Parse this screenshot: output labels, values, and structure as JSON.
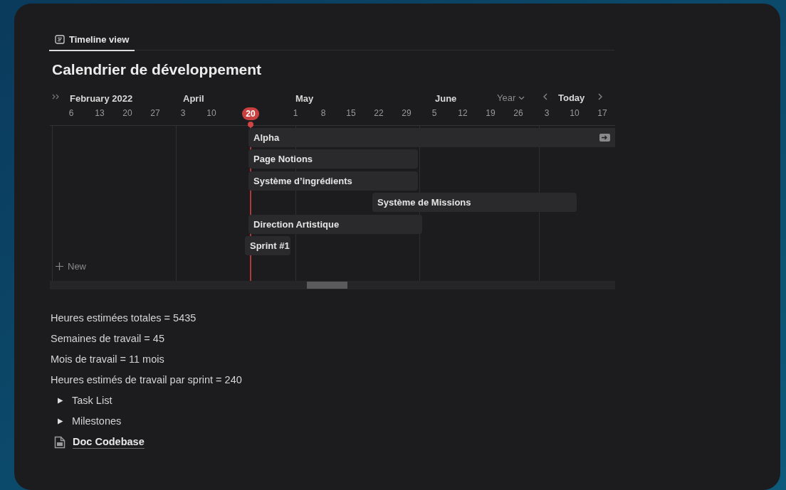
{
  "tabs": [
    {
      "label": "Timeline view",
      "selected": true
    }
  ],
  "title": "Calendrier de développement",
  "timeline": {
    "months": [
      "February 2022",
      "April",
      "May",
      "June"
    ],
    "controls": {
      "scale": "Year",
      "today": "Today"
    },
    "weeks": [
      {
        "label": "6",
        "selected": false
      },
      {
        "label": "13",
        "selected": false
      },
      {
        "label": "20",
        "selected": false
      },
      {
        "label": "27",
        "selected": false
      },
      {
        "label": "3",
        "selected": false
      },
      {
        "label": "10",
        "selected": false
      },
      {
        "label": "20",
        "selected": true
      },
      {
        "label": "1",
        "selected": false
      },
      {
        "label": "8",
        "selected": false
      },
      {
        "label": "15",
        "selected": false
      },
      {
        "label": "22",
        "selected": false
      },
      {
        "label": "29",
        "selected": false
      },
      {
        "label": "5",
        "selected": false
      },
      {
        "label": "12",
        "selected": false
      },
      {
        "label": "19",
        "selected": false
      },
      {
        "label": "26",
        "selected": false
      },
      {
        "label": "3",
        "selected": false
      },
      {
        "label": "10",
        "selected": false
      },
      {
        "label": "17",
        "selected": false
      }
    ],
    "items": [
      {
        "name": "Alpha",
        "continues": true
      },
      {
        "name": "Page Notions",
        "continues": false
      },
      {
        "name": "Système d’ingrédients",
        "continues": false
      },
      {
        "name": "Système de Missions",
        "continues": false
      },
      {
        "name": "Direction Artistique",
        "continues": false
      },
      {
        "name": "Sprint #1",
        "continues": false
      }
    ],
    "new_label": "New"
  },
  "lines": [
    "Heures estimées totales = 5435",
    "Semaines de travail = 45",
    "Mois de travail = 11 mois",
    "Heures estimés de travail par sprint = 240"
  ],
  "toggles": [
    {
      "label": "Task List",
      "expanded": false
    },
    {
      "label": "Milestones",
      "expanded": false
    }
  ],
  "page_link": "Doc Codebase"
}
